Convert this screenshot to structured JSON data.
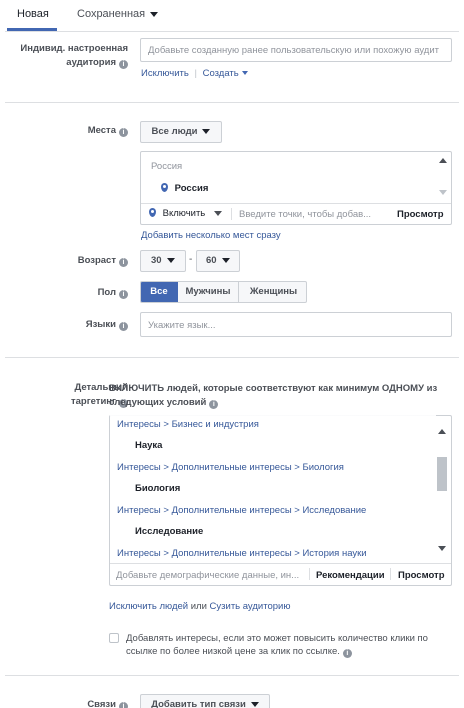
{
  "tabs": {
    "new_label": "Новая",
    "saved_label": "Сохраненная"
  },
  "custom_audience": {
    "label_line1": "Индивид. настроенная",
    "label_line2": "аудитория",
    "placeholder": "Добавьте созданную ранее пользовательскую или похожую аудит",
    "exclude_link": "Исключить",
    "separator": "|",
    "create_link": "Создать"
  },
  "locations": {
    "label": "Места",
    "dropdown_value": "Все люди",
    "box_header": "Россия",
    "selected_item": "Россия",
    "include_value": "Включить",
    "search_placeholder": "Введите точки, чтобы добав...",
    "browse_label": "Просмотр",
    "bulk_link": "Добавить несколько мест сразу"
  },
  "age": {
    "label": "Возраст",
    "min": "30",
    "dash": "-",
    "max": "60"
  },
  "gender": {
    "label": "Пол",
    "options": [
      "Все",
      "Мужчины",
      "Женщины"
    ],
    "selected": "Все"
  },
  "languages": {
    "label": "Языки",
    "placeholder": "Укажите язык..."
  },
  "detailed_targeting": {
    "label_line1": "Детальный",
    "label_line2": "таргетинг",
    "description": "ВКЛЮЧИТЬ людей, которые соответствуют как минимум ОДНОМУ из следующих условий",
    "rows": [
      {
        "kind": "path",
        "text": "Интересы > Бизнес и индустрия"
      },
      {
        "kind": "name",
        "text": "Наука"
      },
      {
        "kind": "path",
        "text": "Интересы > Дополнительные интересы > Биология"
      },
      {
        "kind": "name",
        "text": "Биология"
      },
      {
        "kind": "path",
        "text": "Интересы > Дополнительные интересы > Исследование"
      },
      {
        "kind": "name",
        "text": "Исследование"
      },
      {
        "kind": "path",
        "text": "Интересы > Дополнительные интересы > История науки"
      }
    ],
    "search_placeholder": "Добавьте демографические данные, ин...",
    "suggestions_label": "Рекомендации",
    "browse_label": "Просмотр",
    "exclude_link": "Исключить людей",
    "or_text": "или",
    "narrow_link": "Сузить аудиторию",
    "expand_text": "Добавлять интересы, если это может повысить количество клики по ссылке по более низкой цене за клик по ссылке."
  },
  "connections": {
    "label": "Связи",
    "button_label": "Добавить тип связи"
  },
  "colors": {
    "accent": "#4267b2",
    "link": "#365899",
    "border": "#ccd0d5"
  }
}
